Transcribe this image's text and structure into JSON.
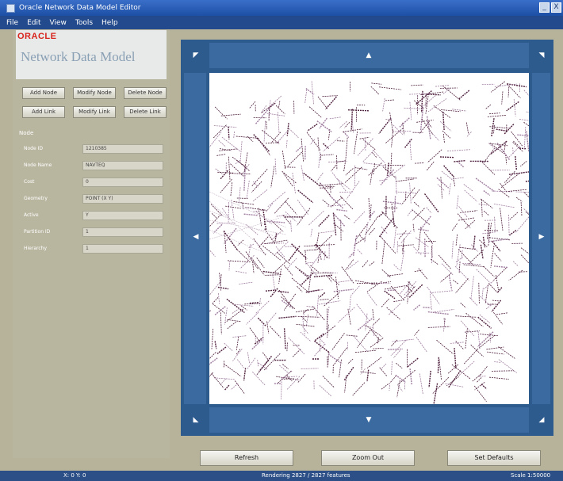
{
  "window": {
    "title": "Oracle Network Data Model Editor",
    "controls": {
      "minimize": "_",
      "close": "X"
    }
  },
  "menu": [
    "File",
    "Edit",
    "View",
    "Tools",
    "Help"
  ],
  "logo": {
    "brand": "ORACLE",
    "product": "Network Data Model"
  },
  "left_buttons": [
    "Add Node",
    "Modify Node",
    "Delete Node",
    "Add Link",
    "Modify Link",
    "Delete Link"
  ],
  "properties": {
    "section_label": "Node",
    "rows": [
      {
        "label": "Node ID",
        "value": "1210385"
      },
      {
        "label": "Node Name",
        "value": "NAVTEQ"
      },
      {
        "label": "Cost",
        "value": "0"
      },
      {
        "label": "Geometry",
        "value": "POINT (X Y)"
      },
      {
        "label": "Active",
        "value": "Y"
      },
      {
        "label": "Partition ID",
        "value": "1"
      },
      {
        "label": "Hierarchy",
        "value": "1"
      }
    ]
  },
  "map": {
    "pan_glyphs": {
      "nw": "◤",
      "n": "▲",
      "ne": "◥",
      "w": "◀",
      "e": "▶",
      "sw": "◣",
      "s": "▼",
      "se": "◢"
    },
    "colors": {
      "frame": "#2e5b8e",
      "roads_primary": "#4d1f3d",
      "roads_secondary": "#a07fa0"
    }
  },
  "bottom_buttons": [
    "Refresh",
    "Zoom Out",
    "Set Defaults"
  ],
  "status": {
    "left": "X: 0 Y: 0",
    "center": "Rendering 2827 / 2827 features",
    "right": "Scale 1:50000"
  }
}
